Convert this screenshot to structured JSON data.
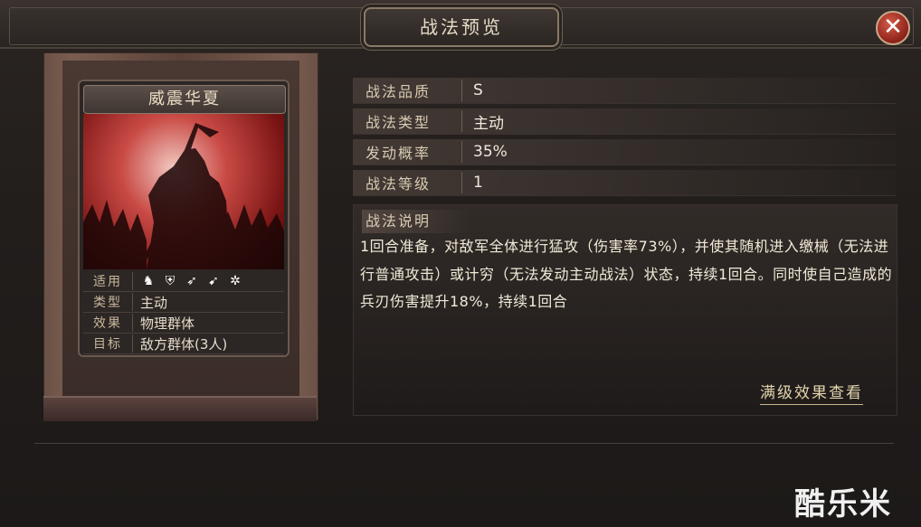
{
  "dialog": {
    "title": "战法预览"
  },
  "card": {
    "name": "威震华夏",
    "stats": [
      {
        "label": "适用",
        "value": ""
      },
      {
        "label": "类型",
        "value": "主动"
      },
      {
        "label": "效果",
        "value": "物理群体"
      },
      {
        "label": "目标",
        "value": "敌方群体(3人)"
      }
    ],
    "units": [
      "cavalry-icon",
      "shield-icon",
      "bow-icon",
      "spear-icon",
      "siege-icon"
    ]
  },
  "info": [
    {
      "label": "战法品质",
      "value": "S"
    },
    {
      "label": "战法类型",
      "value": "主动"
    },
    {
      "label": "发动概率",
      "value": "35%"
    },
    {
      "label": "战法等级",
      "value": "1"
    }
  ],
  "description": {
    "label": "战法说明",
    "text": "1回合准备，对敌军全体进行猛攻（伤害率73%），并使其随机进入缴械（无法进行普通攻击）或计穷（无法发动主动战法）状态，持续1回合。同时使自己造成的兵刃伤害提升18%，持续1回合"
  },
  "full_effect_link": "满级效果查看",
  "watermark": "酷乐米"
}
